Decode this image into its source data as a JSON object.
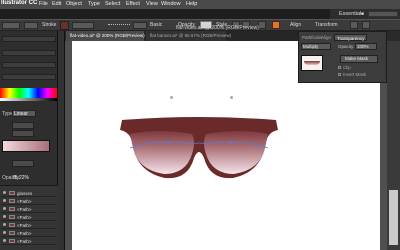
{
  "app": {
    "brand": "llustrator CC",
    "menu": [
      "File",
      "Edit",
      "Object",
      "Type",
      "Select",
      "Effect",
      "View",
      "Window",
      "Help"
    ],
    "window_title": "flat-video.ai* @ 200% (RGB/Preview)",
    "workspace": "Essentials"
  },
  "control_bar": {
    "stroke_label": "Stroke",
    "brush_label": "Basic",
    "opacity_label": "Opacity",
    "style_label": "Style",
    "align_label": "Align",
    "transform_label": "Transform",
    "stroke_color": "#6a2f2c",
    "orange_color": "#d8792c"
  },
  "documents": {
    "tabs": [
      {
        "label": "flat-video.ai* @ 200% (RGB/Preview)",
        "active": true
      },
      {
        "label": "flat banner.ai* @ 66.67% (RGB/Preview)",
        "active": false
      }
    ]
  },
  "gradient_panel": {
    "type_label": "Type:",
    "type_value": "Linear",
    "opacity_label": "Opacity:",
    "location_value": "75.22%"
  },
  "layers": {
    "rows": [
      {
        "name": "glasses"
      },
      {
        "name": "<Path>"
      },
      {
        "name": "<Path>"
      },
      {
        "name": "<Path>"
      },
      {
        "name": "<Path>"
      },
      {
        "name": "<Path>"
      },
      {
        "name": "<Path>"
      }
    ]
  },
  "transparency_panel": {
    "tabs": [
      "Pathfinder",
      "Align",
      "Transparency"
    ],
    "blend_mode": "Multiply",
    "opacity_label": "Opacity:",
    "opacity_value": "100%",
    "make_mask_label": "Make Mask",
    "clip_label": "Clip",
    "invert_mask_label": "Invert Mask"
  },
  "colors": {
    "frame": "#6b2a2a",
    "lens_top": "#7d3a3e",
    "lens_bottom": "#f4e4ea",
    "canvas": "#ffffff",
    "pasteboard": "#4f4f4f"
  }
}
